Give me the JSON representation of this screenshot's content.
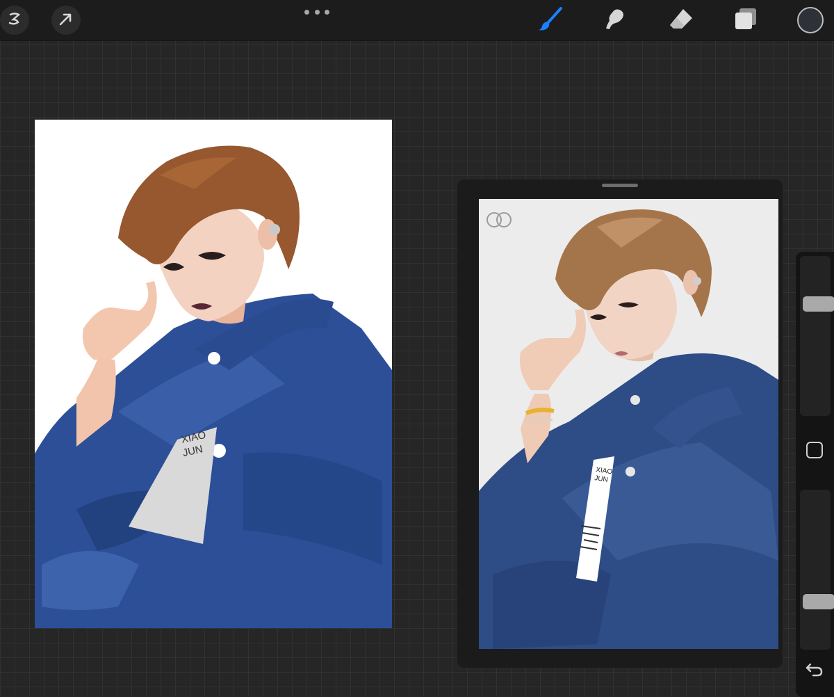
{
  "toolbar": {
    "gallery_icon": "procreate-s-icon",
    "actions_icon": "cursor-arrow-icon",
    "more_icon": "ellipsis-icon",
    "brush_icon": "paintbrush-icon",
    "smudge_icon": "smudge-icon",
    "eraser_icon": "eraser-icon",
    "layers_icon": "layers-icon",
    "active_tool": "brush",
    "accent_color": "#1a80ff",
    "current_color": "#2e3138"
  },
  "canvas": {
    "badge_text_line1": "XIAO",
    "badge_text_line2": "JUN"
  },
  "reference": {
    "badge_text_line1": "XIAO",
    "badge_text_line2": "JUN"
  },
  "sidebar": {
    "brush_size_level": 0.72,
    "opacity_level": 0.28,
    "modify_icon": "square-outline-icon",
    "undo_icon": "undo-arrow-icon"
  }
}
